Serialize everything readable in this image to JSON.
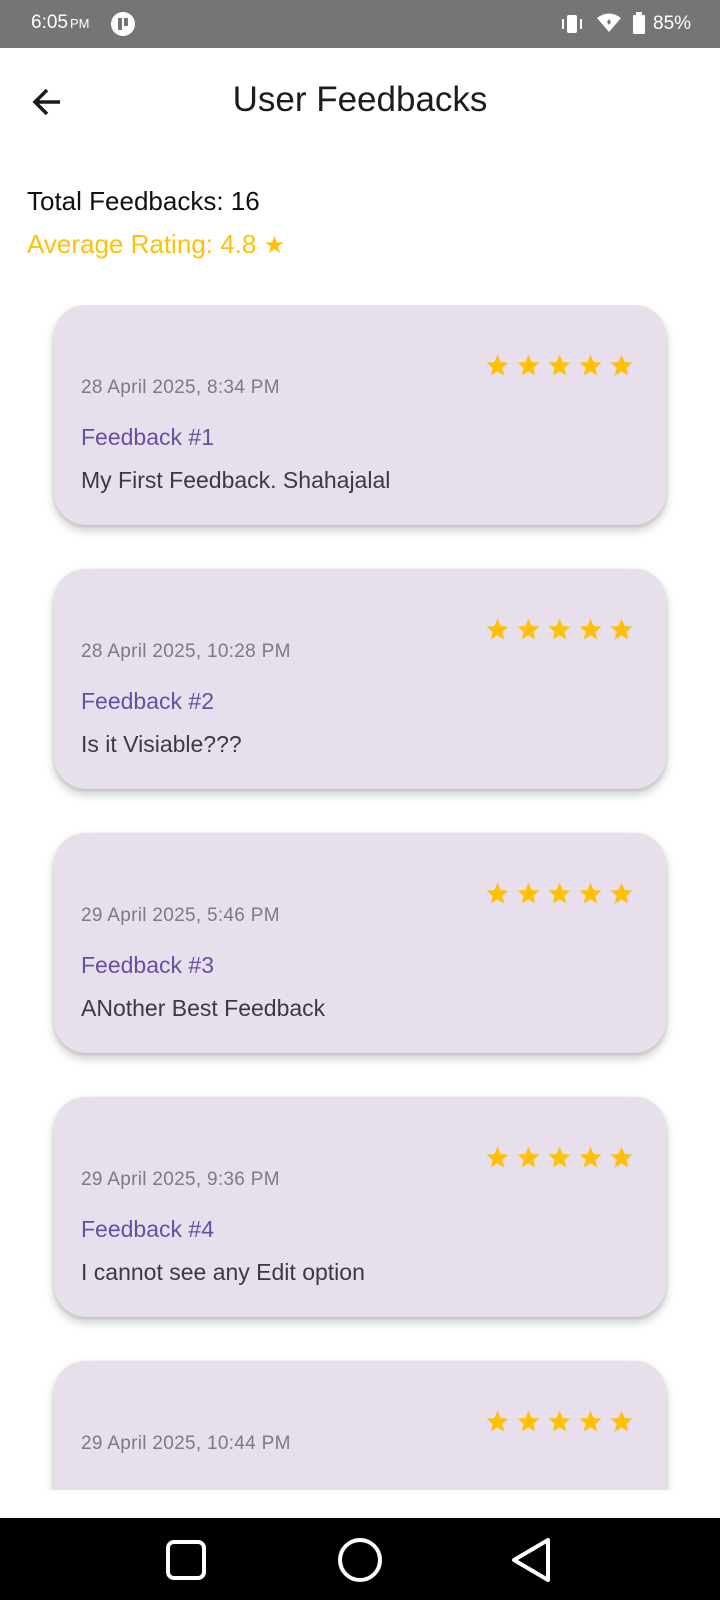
{
  "status_bar": {
    "time": "6:05",
    "ampm": "PM",
    "battery": "85%",
    "icons": [
      "app-status-icon",
      "vibrate-icon",
      "wifi-icon",
      "battery-icon"
    ]
  },
  "app_bar": {
    "title": "User Feedbacks",
    "back_icon": "arrow-left-icon"
  },
  "summary": {
    "total_label": "Total Feedbacks: 16",
    "average_label": "Average Rating: 4.8",
    "average_star": "★"
  },
  "colors": {
    "accent_purple": "#6750a4",
    "star_gold": "#ffc107",
    "card_background": "#e7dfeb",
    "status_bar": "#757575",
    "nav_bar": "#000000"
  },
  "feedbacks": [
    {
      "date": "28 April 2025, 8:34 PM",
      "title": "Feedback #1",
      "message": "My First Feedback. Shahajalal",
      "rating": 5
    },
    {
      "date": "28 April 2025, 10:28 PM",
      "title": "Feedback #2",
      "message": "Is it Visiable???",
      "rating": 5
    },
    {
      "date": "29 April 2025, 5:46 PM",
      "title": "Feedback #3",
      "message": "ANother Best Feedback",
      "rating": 5
    },
    {
      "date": "29 April 2025, 9:36 PM",
      "title": "Feedback #4",
      "message": "I cannot see any Edit option",
      "rating": 5
    },
    {
      "date": "29 April 2025, 10:44 PM",
      "title": "",
      "message": "",
      "rating": 5
    }
  ],
  "nav_bar": {
    "icons": [
      "square-recents-icon",
      "circle-home-icon",
      "triangle-back-icon"
    ]
  }
}
